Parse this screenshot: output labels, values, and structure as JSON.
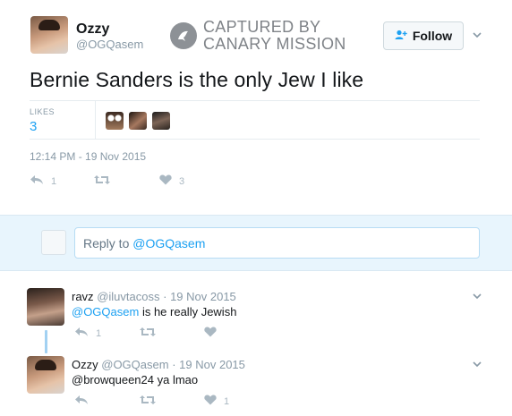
{
  "tweet": {
    "author_name": "Ozzy",
    "author_handle": "@OGQasem",
    "follow_label": "Follow",
    "text": "Bernie Sanders is the only Jew I like",
    "likes_label": "LIKES",
    "likes_count": "3",
    "timestamp": "12:14 PM - 19 Nov 2015",
    "reply_count": "1",
    "like_action_count": "3"
  },
  "watermark": {
    "line1": "CAPTURED BY",
    "line2": "CANARY MISSION"
  },
  "reply_box": {
    "prefix": "Reply to ",
    "mention": "@OGQasem"
  },
  "replies": [
    {
      "name": "ravz",
      "handle": "@iluvtacoss",
      "date": "19 Nov 2015",
      "mention": "@OGQasem",
      "text": " is he really Jewish",
      "reply_count": "1",
      "like_count": ""
    },
    {
      "name": "Ozzy",
      "handle": "@OGQasem",
      "date": "19 Nov 2015",
      "mention": "",
      "text": "@browqueen24 ya lmao",
      "reply_count": "",
      "like_count": "1"
    }
  ],
  "icons": {
    "reply": "reply-arrow-icon",
    "retweet": "retweet-icon",
    "like": "heart-icon",
    "follow": "add-user-icon",
    "caret": "chevron-down-icon",
    "watermark_logo": "canary-bird-icon"
  },
  "colors": {
    "link": "#1da1f2",
    "muted": "#8899a6",
    "action": "#aab8c2",
    "reply_band": "#e8f5fd"
  }
}
